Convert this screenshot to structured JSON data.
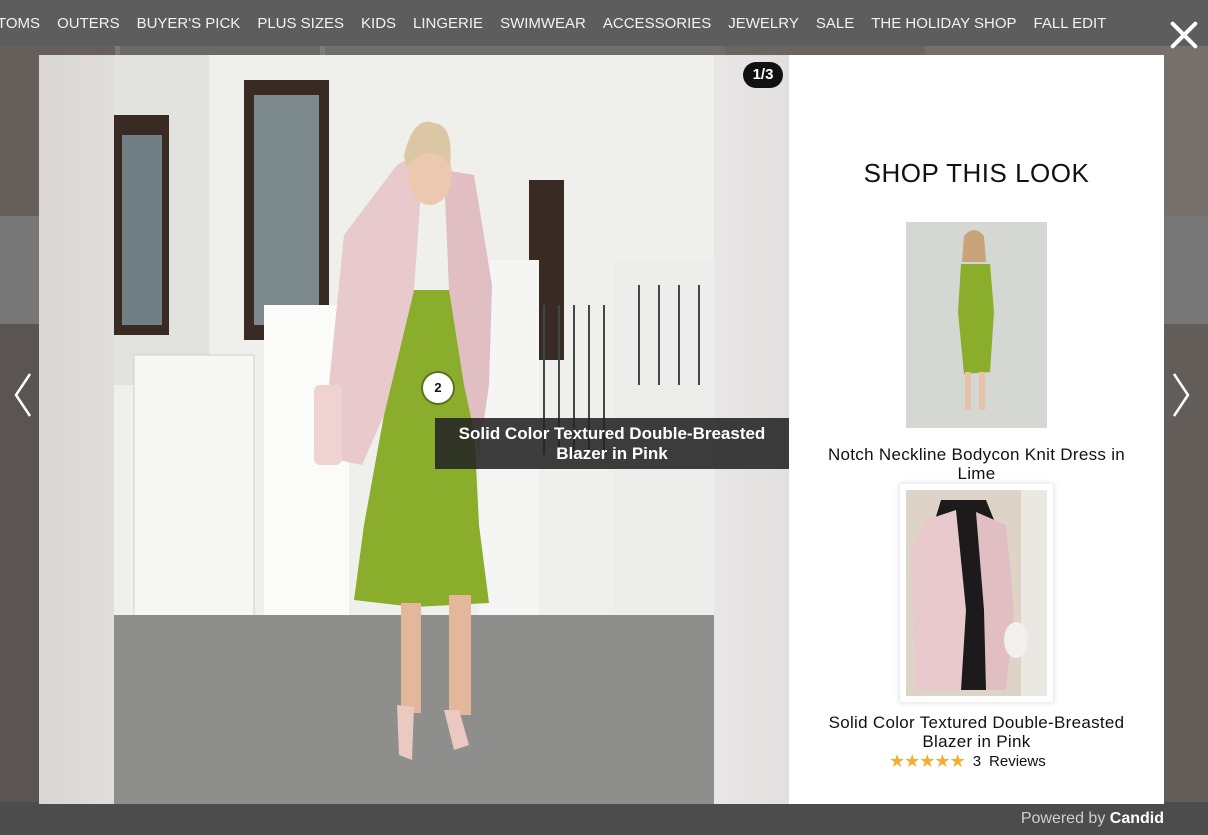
{
  "nav": {
    "items": [
      "TOMS",
      "OUTERS",
      "BUYER'S PICK",
      "PLUS SIZES",
      "KIDS",
      "LINGERIE",
      "SWIMWEAR",
      "ACCESSORIES",
      "JEWELRY",
      "SALE",
      "THE HOLIDAY SHOP",
      "FALL EDIT"
    ]
  },
  "modal": {
    "counter": "1/3",
    "hotspot_number": "2",
    "tooltip": "Solid Color Textured Double-Breasted Blazer in Pink",
    "title": "SHOP THIS LOOK",
    "products": [
      {
        "name": "Notch Neckline Bodycon Knit Dress in Lime"
      },
      {
        "name": "Solid Color Textured Double-Breasted Blazer in Pink",
        "review_count": "3",
        "reviews_label": "Reviews",
        "rating": 5
      }
    ],
    "icons": {
      "close": "close-icon",
      "prev": "chevron-left-icon",
      "next": "chevron-right-icon"
    }
  },
  "footer": {
    "powered_prefix": "Powered by",
    "brand": "Candid"
  },
  "colors": {
    "overlay": "#4a4a4a",
    "tooltip_bg": "#232323",
    "star": "#f2b02e",
    "dress": "#8aae2c",
    "blazer": "#e8c9cc"
  }
}
